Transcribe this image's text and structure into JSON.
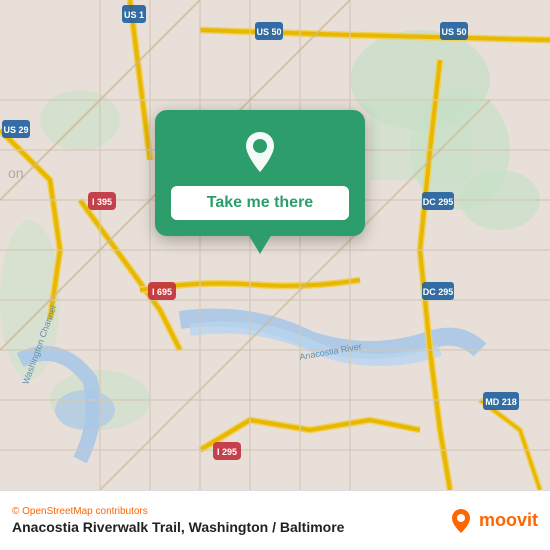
{
  "map": {
    "background_color": "#e8e0d8"
  },
  "popup": {
    "button_label": "Take me there",
    "bg_color": "#2d9e6b"
  },
  "bottom_bar": {
    "attribution": "© OpenStreetMap contributors",
    "location_title": "Anacostia Riverwalk Trail, Washington / Baltimore",
    "moovit_label": "moovit"
  }
}
